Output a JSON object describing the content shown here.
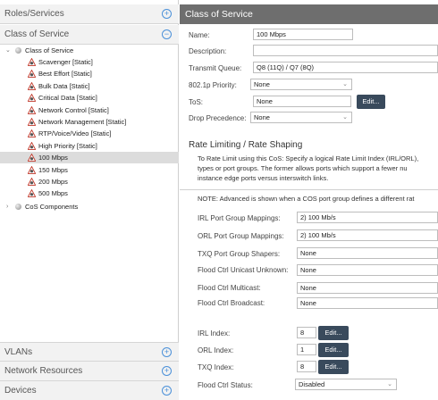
{
  "sidebar": {
    "sections_top": [
      {
        "title": "Roles/Services",
        "toggle": "+"
      },
      {
        "title": "Class of Service",
        "toggle": "−"
      }
    ],
    "tree": {
      "root": {
        "label": "Class of Service",
        "expander": "⌄"
      },
      "items": [
        {
          "label": "Scavenger [Static]"
        },
        {
          "label": "Best Effort [Static]"
        },
        {
          "label": "Bulk Data [Static]"
        },
        {
          "label": "Critical Data [Static]"
        },
        {
          "label": "Network Control [Static]"
        },
        {
          "label": "Network Management [Static]"
        },
        {
          "label": "RTP/Voice/Video [Static]"
        },
        {
          "label": "High Priority [Static]"
        },
        {
          "label": "100 Mbps",
          "selected": true
        },
        {
          "label": "150 Mbps"
        },
        {
          "label": "200 Mbps"
        },
        {
          "label": "500 Mbps"
        }
      ],
      "components": {
        "label": "CoS Components",
        "expander": "›"
      }
    },
    "sections_bottom": [
      {
        "title": "VLANs",
        "toggle": "+"
      },
      {
        "title": "Network Resources",
        "toggle": "+"
      },
      {
        "title": "Devices",
        "toggle": "+"
      }
    ]
  },
  "panel": {
    "title": "Class of Service",
    "name_label": "Name:",
    "name_value": "100 Mbps",
    "description_label": "Description:",
    "description_value": "",
    "transmit_queue_label": "Transmit Queue:",
    "transmit_queue_value": "Q8 (11Q) / Q7 (8Q)",
    "priority_label": "802.1p Priority:",
    "priority_value": "None",
    "tos_label": "ToS:",
    "tos_value": "None",
    "edit_label": "Edit...",
    "drop_precedence_label": "Drop Precedence:",
    "drop_precedence_value": "None"
  },
  "rate": {
    "title": "Rate Limiting / Rate Shaping",
    "desc_lines": [
      "To Rate Limit using this CoS: Specify a logical Rate Limit Index (IRL/ORL),",
      "types or port groups. The former allows ports which support a fewer nu",
      "instance edge ports versus interswitch links."
    ],
    "note": "NOTE: Advanced is shown when a COS port group defines a different rat",
    "irl_mappings_label": "IRL Port Group Mappings:",
    "irl_mappings_value": "2) 100 Mb/s",
    "orl_mappings_label": "ORL Port Group Mappings:",
    "orl_mappings_value": "2) 100 Mb/s",
    "txq_shapers_label": "TXQ Port Group Shapers:",
    "txq_shapers_value": "None",
    "flood_unicast_label": "Flood Ctrl Unicast Unknown:",
    "flood_unicast_value": "None",
    "flood_multicast_label": "Flood Ctrl Multicast:",
    "flood_multicast_value": "None",
    "flood_broadcast_label": "Flood Ctrl Broadcast:",
    "flood_broadcast_value": "None",
    "irl_index_label": "IRL Index:",
    "irl_index_value": "8",
    "orl_index_label": "ORL Index:",
    "orl_index_value": "1",
    "txq_index_label": "TXQ Index:",
    "txq_index_value": "8",
    "flood_status_label": "Flood Ctrl Status:",
    "flood_status_value": "Disabled",
    "edit_label": "Edit..."
  },
  "colors": {
    "header_bg": "#6e6e6e",
    "button_bg": "#394a5c",
    "accent": "#4a90d9",
    "selected_row": "#dcdcdc"
  }
}
